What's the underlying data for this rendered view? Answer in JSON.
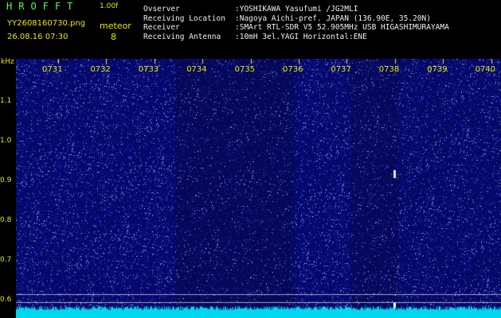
{
  "app": {
    "logo_text": "HROFFT",
    "version": "1.00f",
    "filename": "YY2608160730.png",
    "datetime": "26.08.16 07:30",
    "meteor_label": "meteor",
    "meteor_count": "8"
  },
  "info": [
    {
      "key": "Ovserver",
      "value": ":YOSHIKAWA Yasufumi /JG2MLI"
    },
    {
      "key": "Receiving Location",
      "value": ":Nagoya Aichi-pref. JAPAN (136.90E, 35.20N)"
    },
    {
      "key": "Receiver",
      "value": ":SMArt RTL-SDR V5 52.905MHz USB HIGASHIMURAYAMA"
    },
    {
      "key": "Receiving Antenna",
      "value": ":10mH 3el.YAGI Horizontal:ENE"
    }
  ],
  "axis": {
    "unit": "kHz",
    "y_ticks": [
      "1.1",
      "1.0",
      "0.9",
      "0.8",
      "0.7",
      "0.6"
    ],
    "x_ticks": [
      "0731",
      "0732",
      "0733",
      "0734",
      "0735",
      "0736",
      "0737",
      "0738",
      "0739",
      "0740"
    ]
  },
  "colors": {
    "background": "#000000",
    "waterfall_base": "#0a0a6e",
    "noise_strip": "#00e5ff",
    "label_yellow": "#e8e800",
    "logo_green": "#4cff4c"
  }
}
